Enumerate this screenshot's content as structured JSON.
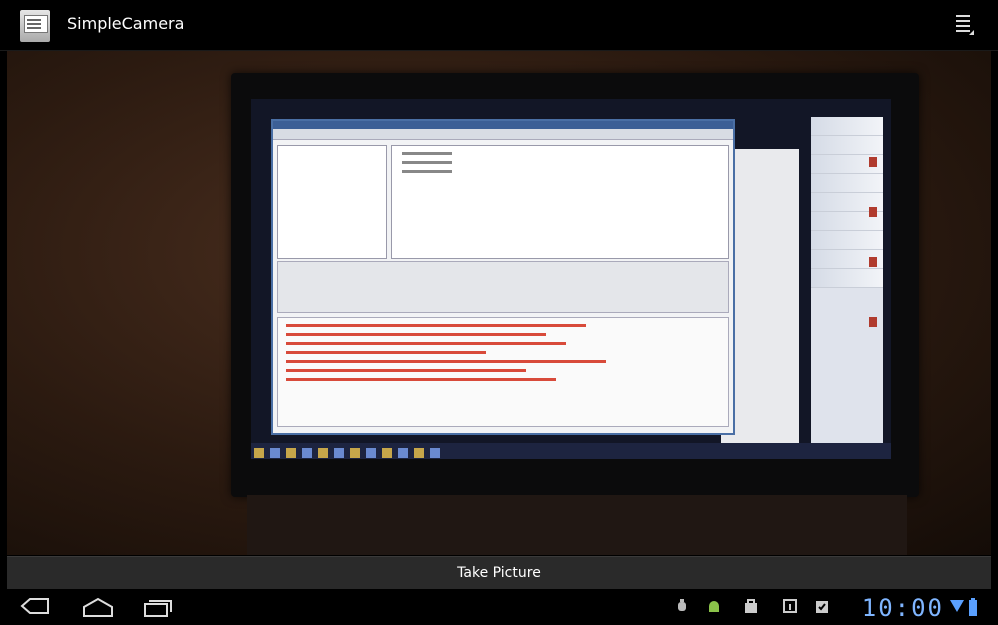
{
  "app": {
    "title": "SimpleCamera",
    "icon": "camera-app-icon"
  },
  "action_bar": {
    "overflow_icon": "overflow-menu-icon"
  },
  "camera_button": {
    "label": "Take Picture"
  },
  "system_bar": {
    "nav": {
      "back_icon": "back-icon",
      "home_icon": "home-icon",
      "recent_icon": "recent-apps-icon"
    },
    "notifications": [
      "usb-debug-icon",
      "android-icon",
      "store-icon",
      "calendar-icon",
      "clipboard-check-icon"
    ],
    "clock": "10:00",
    "status_icons": [
      "wifi-icon",
      "battery-icon"
    ]
  },
  "colors": {
    "clock": "#7fb5ff",
    "bar_bg": "#000000",
    "button_bg": "#2a2a2a"
  }
}
